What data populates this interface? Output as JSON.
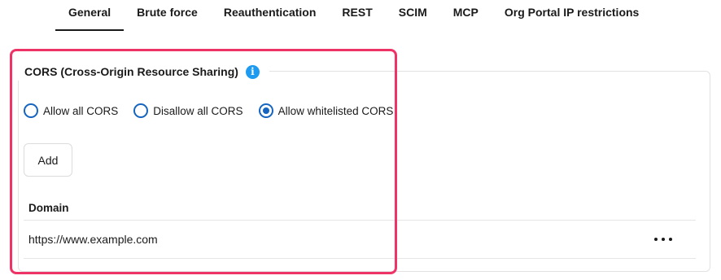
{
  "tabs": [
    {
      "label": "General",
      "active": true
    },
    {
      "label": "Brute force"
    },
    {
      "label": "Reauthentication"
    },
    {
      "label": "REST"
    },
    {
      "label": "SCIM"
    },
    {
      "label": "MCP"
    },
    {
      "label": "Org Portal IP restrictions"
    }
  ],
  "cors": {
    "title": "CORS (Cross-Origin Resource Sharing)",
    "info_icon": "info-icon",
    "options": [
      {
        "label": "Allow all CORS",
        "checked": false
      },
      {
        "label": "Disallow all CORS",
        "checked": false
      },
      {
        "label": "Allow whitelisted CORS",
        "checked": true
      }
    ],
    "add_label": "Add",
    "table": {
      "header_domain": "Domain",
      "rows": [
        {
          "domain": "https://www.example.com",
          "action_icon": "more-horizontal-icon"
        }
      ]
    }
  },
  "colors": {
    "accent": "#1565c0",
    "info": "#1e9bf0",
    "highlight": "#ee3467"
  }
}
